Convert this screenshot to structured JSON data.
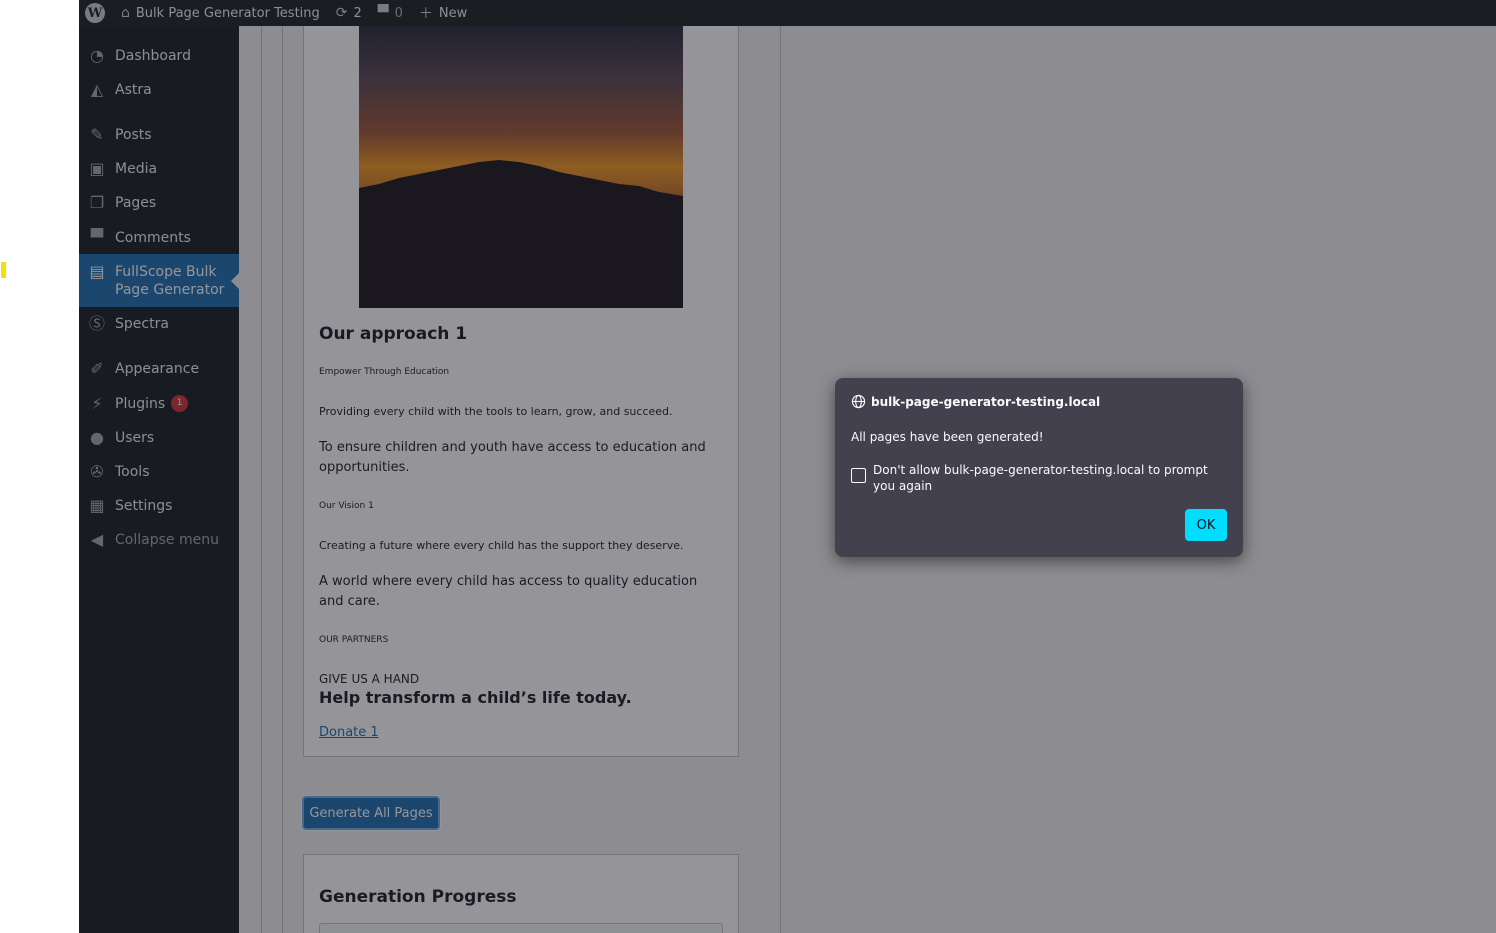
{
  "admin_bar": {
    "site_title": "Bulk Page Generator Testing",
    "updates_count": "2",
    "comments_count": "0",
    "new_label": "New"
  },
  "sidebar": {
    "items": [
      {
        "label": "Dashboard",
        "icon": "dashboard-icon"
      },
      {
        "label": "Astra",
        "icon": "astra-icon"
      },
      {
        "label": "Posts",
        "icon": "pin-icon"
      },
      {
        "label": "Media",
        "icon": "media-icon"
      },
      {
        "label": "Pages",
        "icon": "pages-icon"
      },
      {
        "label": "Comments",
        "icon": "comment-icon"
      },
      {
        "label": "FullScope Bulk Page Generator",
        "icon": "document-icon",
        "active": true
      },
      {
        "label": "Spectra",
        "icon": "spectra-icon"
      },
      {
        "label": "Appearance",
        "icon": "brush-icon"
      },
      {
        "label": "Plugins",
        "icon": "plugin-icon",
        "badge": "1"
      },
      {
        "label": "Users",
        "icon": "user-icon"
      },
      {
        "label": "Tools",
        "icon": "wrench-icon"
      },
      {
        "label": "Settings",
        "icon": "settings-icon"
      },
      {
        "label": "Collapse menu",
        "icon": "collapse-icon"
      }
    ]
  },
  "preview": {
    "approach_title": "Our approach 1",
    "approach_tagline": "Empower Through Education",
    "approach_desc": "Providing every child with the tools to learn, grow, and succeed.",
    "mission_text": "To ensure children and youth have access to education and opportunities.",
    "vision_title": "Our Vision 1",
    "vision_desc": "Creating a future where every child has the support they deserve.",
    "vision_text": "A world where every child has access to quality education and care.",
    "partners_label": "OUR PARTNERS",
    "cta_kicker": "GIVE US A HAND",
    "cta_heading": "Help transform a child’s life today.",
    "donate_link": "Donate 1"
  },
  "generate_button": "Generate All Pages",
  "progress": {
    "title": "Generation Progress"
  },
  "dialog": {
    "origin": "bulk-page-generator-testing.local",
    "message": "All pages have been generated!",
    "checkbox_label": "Don't allow bulk-page-generator-testing.local to prompt you again",
    "checkbox_checked": false,
    "ok_label": "OK",
    "accent_color": "#00ddff",
    "background_color": "#42414d"
  }
}
